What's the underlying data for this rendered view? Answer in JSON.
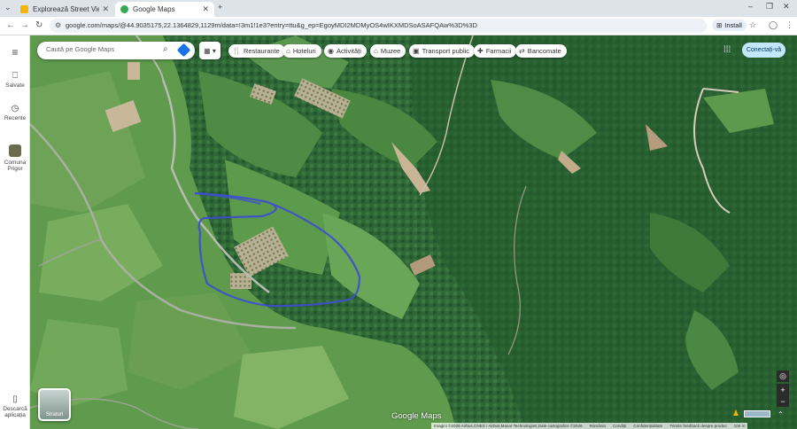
{
  "browser": {
    "tabs": [
      {
        "title": "Explorează Street View și adău"
      },
      {
        "title": "Google Maps"
      }
    ],
    "url": "google.com/maps/@44.9035175,22.1364829,1129m/data=!3m1!1e3?entry=ttu&g_ep=EgoyMDI2MDMyOS4wIKXMDSoASAFQAw%3D%3D",
    "install_label": "Install"
  },
  "sidebar": {
    "items": [
      {
        "label": "Salvate",
        "icon": "bookmark-icon"
      },
      {
        "label": "Recente",
        "icon": "history-icon"
      },
      {
        "label": "Comuna Prigor",
        "icon": "place-thumbnail"
      },
      {
        "label": "Descarcă aplicația",
        "icon": "phone-icon"
      }
    ]
  },
  "search": {
    "placeholder": "Caută pe Google Maps"
  },
  "chips": [
    {
      "label": "Restaurante",
      "icon": "restaurant-icon"
    },
    {
      "label": "Hoteluri",
      "icon": "hotel-icon"
    },
    {
      "label": "Activități",
      "icon": "activities-icon"
    },
    {
      "label": "Muzee",
      "icon": "museum-icon"
    },
    {
      "label": "Transport public",
      "icon": "transit-icon"
    },
    {
      "label": "Farmacii",
      "icon": "pharmacy-icon"
    },
    {
      "label": "Bancomate",
      "icon": "atm-icon"
    }
  ],
  "signin_label": "Conectați-vă",
  "map": {
    "layers_label": "Straturi",
    "logo": "Google Maps",
    "attribution": [
      "Imagini ©2026 Airbus,CNES / Airbus,Maxar Technologies,Date cartografice ©2026",
      "România",
      "Condiții",
      "Confidențialitate",
      "Trimite feedback despre produs",
      "100 m"
    ],
    "colors": {
      "outline": "#3c4fcf",
      "forest": "#2f6a39"
    }
  }
}
